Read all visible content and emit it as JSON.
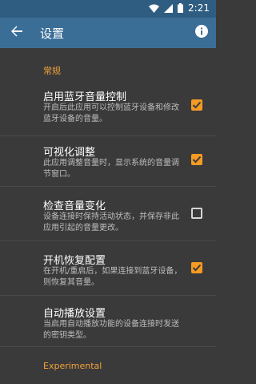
{
  "status": {
    "time": "2:21"
  },
  "appbar": {
    "title": "设置"
  },
  "sections": [
    {
      "label": "常规"
    },
    {
      "label": "Experimental"
    }
  ],
  "items": [
    {
      "title": "启用蓝牙音量控制",
      "subtitle": "开启后此应用可以控制蓝牙设备和修改蓝牙设备的音量。",
      "checked": true
    },
    {
      "title": "可视化调整",
      "subtitle": "此应用调整音量时，显示系统的音量调节窗口。",
      "checked": true
    },
    {
      "title": "检查音量变化",
      "subtitle": "设备连接时保持活动状态，并保存非此应用引起的音量更改。",
      "checked": false
    },
    {
      "title": "开机恢复配置",
      "subtitle": "在开机/重启后，如果连接到蓝牙设备，则恢复其音量。",
      "checked": true
    },
    {
      "title": "自动播放设置",
      "subtitle": "当启用自动播放功能的设备连接时发送的密钥类型。"
    }
  ],
  "colors": {
    "accent": "#f59a23",
    "toolbar": "#3b6e97",
    "statusbar": "#2f5d82",
    "background": "#3a3a3a"
  }
}
